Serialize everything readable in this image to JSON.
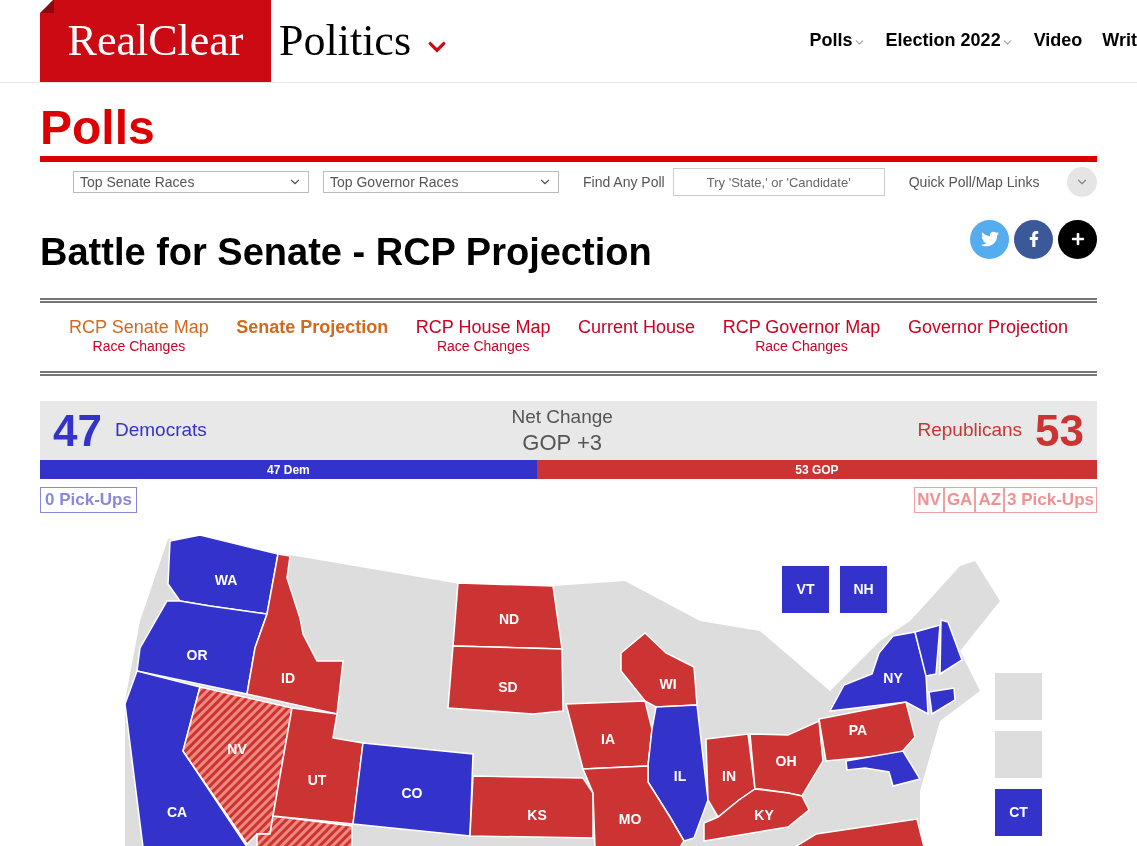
{
  "header": {
    "logo": {
      "part1": "RealClear",
      "part2": "Politics"
    },
    "nav": [
      {
        "label": "Polls",
        "has_menu": true
      },
      {
        "label": "Election 2022",
        "has_menu": true
      },
      {
        "label": "Video",
        "has_menu": false
      },
      {
        "label": "Writ",
        "has_menu": false
      }
    ]
  },
  "page_title": "Polls",
  "filters": {
    "selects": [
      "Top Senate Races",
      "Top Governor Races"
    ],
    "find_label": "Find Any Poll",
    "search": {
      "placeholder": "Try 'State,' or 'Candidate'"
    },
    "quick_links": "Quick Poll/Map Links"
  },
  "heading": "Battle for Senate - RCP Projection",
  "tabs": [
    {
      "label": "RCP Senate Map",
      "sublabel": "Race Changes",
      "selected": false,
      "color": "#d2691e"
    },
    {
      "label": "Senate Projection",
      "selected": true,
      "color": "#d2691e"
    },
    {
      "label": "RCP House Map",
      "sublabel": "Race Changes",
      "selected": false,
      "color": "#cc0022"
    },
    {
      "label": "Current House",
      "selected": false,
      "color": "#cc0022"
    },
    {
      "label": "RCP Governor Map",
      "sublabel": "Race Changes",
      "selected": false,
      "color": "#cc0022"
    },
    {
      "label": "Governor Projection",
      "selected": false,
      "color": "#cc0022"
    }
  ],
  "summary": {
    "dem": {
      "count": "47",
      "label": "Democrats"
    },
    "net": {
      "label": "Net Change",
      "value": "GOP +3"
    },
    "gop": {
      "label": "Republicans",
      "count": "53"
    },
    "bar": {
      "level": 0.47,
      "dem_label": "47 Dem",
      "gop_label": "53 GOP"
    }
  },
  "pickups": {
    "dem": [
      "0 Pick-Ups"
    ],
    "gop": [
      "NV",
      "GA",
      "AZ",
      "3 Pick-Ups"
    ]
  },
  "map": {
    "states": [
      {
        "label": "WA",
        "color": "#3333cc",
        "pickup": false
      },
      {
        "label": "OR",
        "color": "#3333cc",
        "pickup": false
      },
      {
        "label": "CA",
        "color": "#3333cc",
        "pickup": false
      },
      {
        "label": "NV",
        "color": "#cc3333",
        "pickup": true
      },
      {
        "color": "#cc3333",
        "pickup": true
      },
      {
        "label": "ID",
        "color": "#cc3333",
        "pickup": false
      },
      {
        "label": "UT",
        "color": "#cc3333",
        "pickup": false
      },
      {
        "label": "CO",
        "color": "#3333cc",
        "pickup": false
      },
      {
        "label": "ND",
        "color": "#cc3333",
        "pickup": false
      },
      {
        "label": "SD",
        "color": "#cc3333",
        "pickup": false
      },
      {
        "label": "KS",
        "color": "#cc3333",
        "pickup": false
      },
      {
        "label": "IA",
        "color": "#cc3333",
        "pickup": false
      },
      {
        "label": "WI",
        "color": "#cc3333",
        "pickup": false
      },
      {
        "label": "IL",
        "color": "#3333cc",
        "pickup": false
      },
      {
        "label": "MO",
        "color": "#cc3333",
        "pickup": false
      },
      {
        "label": "IN",
        "color": "#cc3333",
        "pickup": false
      },
      {
        "label": "OH",
        "color": "#cc3333",
        "pickup": false
      },
      {
        "label": "KY",
        "color": "#cc3333",
        "pickup": false
      },
      {
        "color": "#cc3333",
        "pickup": false
      },
      {
        "label": "PA",
        "color": "#cc3333",
        "pickup": false
      },
      {
        "label": "NY",
        "color": "#3333cc",
        "pickup": false
      },
      {
        "color": "#3333cc",
        "pickup": false
      },
      {
        "color": "#3333cc",
        "pickup": false
      },
      {
        "color": "#3333cc",
        "pickup": false
      },
      {
        "color": "#3333cc",
        "pickup": false
      }
    ],
    "boxes": [
      {
        "label": "VT",
        "color": "#3333cc"
      },
      {
        "label": "NH",
        "color": "#3333cc"
      },
      {
        "color": "#dddddd"
      },
      {
        "color": "#dddddd"
      },
      {
        "label": "CT",
        "color": "#3333cc"
      }
    ]
  }
}
